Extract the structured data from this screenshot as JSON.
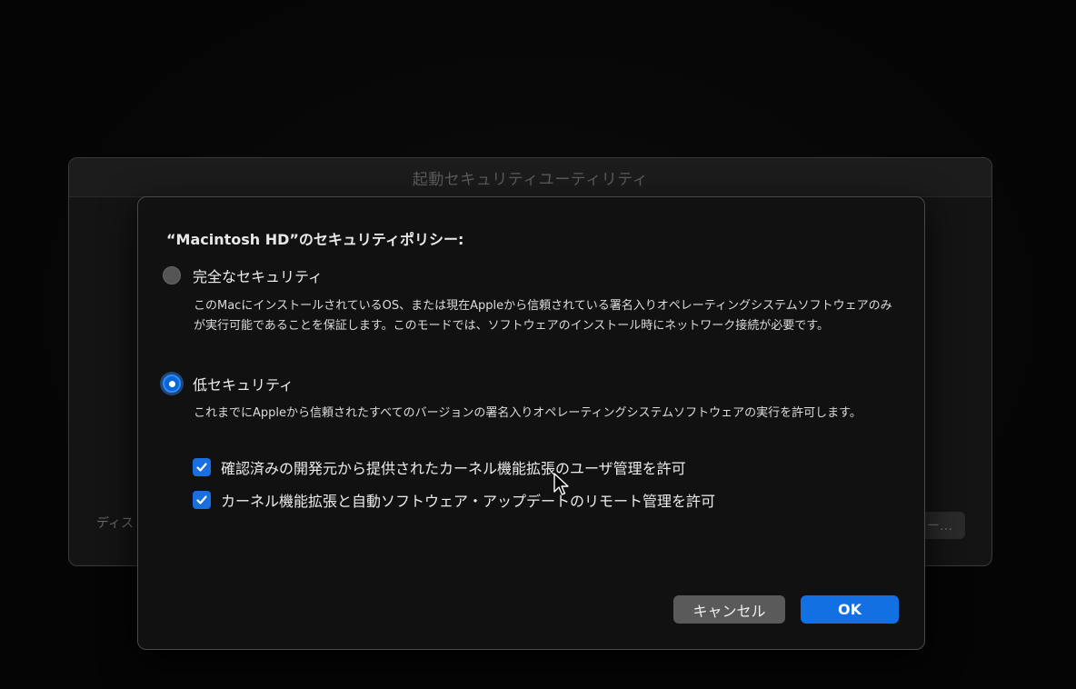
{
  "background_window": {
    "title": "起動セキュリティユーティリティ",
    "left_label": "ディス",
    "right_button_label": "ー…"
  },
  "dialog": {
    "heading": "“Macintosh HD”のセキュリティポリシー:",
    "options": [
      {
        "label": "完全なセキュリティ",
        "selected": false,
        "description": "このMacにインストールされているOS、または現在Appleから信頼されている署名入りオペレーティングシステムソフトウェアのみが実行可能であることを保証します。このモードでは、ソフトウェアのインストール時にネットワーク接続が必要です。"
      },
      {
        "label": "低セキュリティ",
        "selected": true,
        "description": "これまでにAppleから信頼されたすべてのバージョンの署名入りオペレーティングシステムソフトウェアの実行を許可します。"
      }
    ],
    "checkboxes": [
      {
        "label": "確認済みの開発元から提供されたカーネル機能拡張のユーザ管理を許可",
        "checked": true
      },
      {
        "label": "カーネル機能拡張と自動ソフトウェア・アップデートのリモート管理を許可",
        "checked": true
      }
    ],
    "cancel_label": "キャンセル",
    "ok_label": "OK"
  },
  "colors": {
    "accent": "#1270e3",
    "radio_selected": "#0a66d6",
    "checkbox": "#1a6fe0",
    "cancel_button": "#5a5a5a"
  }
}
